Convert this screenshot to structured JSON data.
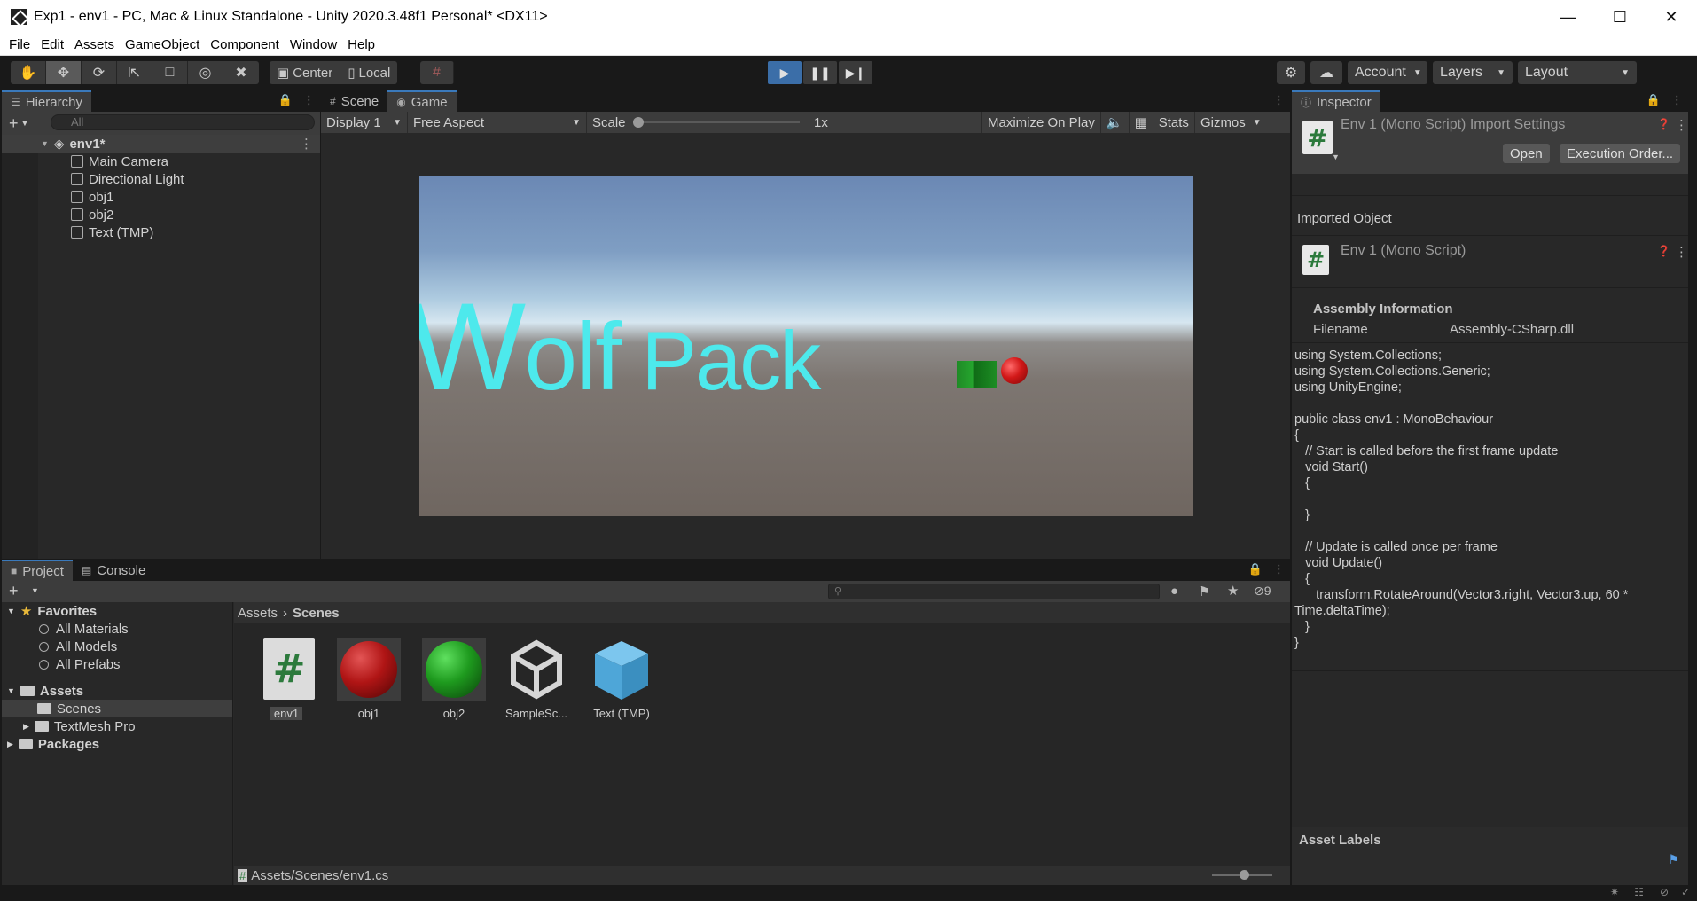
{
  "window": {
    "title": "Exp1 - env1 - PC, Mac & Linux Standalone - Unity 2020.3.48f1 Personal* <DX11>"
  },
  "menu": [
    "File",
    "Edit",
    "Assets",
    "GameObject",
    "Component",
    "Window",
    "Help"
  ],
  "toolbar": {
    "pivot": "Center",
    "space": "Local",
    "account": "Account",
    "layers": "Layers",
    "layout": "Layout"
  },
  "hierarchy": {
    "tab": "Hierarchy",
    "search_placeholder": "All",
    "scene": "env1*",
    "items": [
      "Main Camera",
      "Directional Light",
      "obj1",
      "obj2",
      "Text (TMP)"
    ]
  },
  "game": {
    "tabs": [
      "Scene",
      "Game"
    ],
    "display": "Display 1",
    "aspect": "Free Aspect",
    "scale_label": "Scale",
    "scale_value": "1x",
    "maximize": "Maximize On Play",
    "stats": "Stats",
    "gizmos": "Gizmos",
    "text_big": "W",
    "text_ol": "olf",
    "text_pack": " Pack"
  },
  "inspector": {
    "tab": "Inspector",
    "title": "Env 1 (Mono Script) Import Settings",
    "open": "Open",
    "exec_order": "Execution Order...",
    "imported_object": "Imported Object",
    "object_name": "Env 1 (Mono Script)",
    "assembly_info": "Assembly Information",
    "filename_label": "Filename",
    "filename_value": "Assembly-CSharp.dll",
    "code": "using System.Collections;\nusing System.Collections.Generic;\nusing UnityEngine;\n\npublic class env1 : MonoBehaviour\n{\n   // Start is called before the first frame update\n   void Start()\n   {\n\n   }\n\n   // Update is called once per frame\n   void Update()\n   {\n      transform.RotateAround(Vector3.right, Vector3.up, 60 *\nTime.deltaTime);\n   }\n}",
    "asset_labels": "Asset Labels"
  },
  "project": {
    "tabs": [
      "Project",
      "Console"
    ],
    "hidden_count": "9",
    "favorites": "Favorites",
    "fav_items": [
      "All Materials",
      "All Models",
      "All Prefabs"
    ],
    "assets": "Assets",
    "asset_children": [
      "Scenes",
      "TextMesh Pro"
    ],
    "packages": "Packages",
    "breadcrumb": [
      "Assets",
      "Scenes"
    ],
    "files": [
      "env1",
      "obj1",
      "obj2",
      "SampleSc...",
      "Text (TMP)"
    ],
    "status_path": "Assets/Scenes/env1.cs"
  },
  "colors": {
    "accent": "#3b6ea8",
    "text_cyan": "#4de9ec",
    "obj1": "#d21818",
    "obj2": "#25a52e"
  }
}
